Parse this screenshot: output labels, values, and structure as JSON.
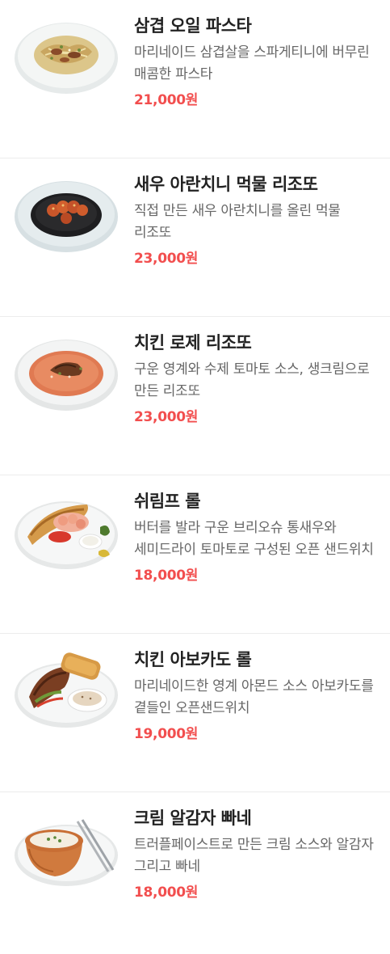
{
  "colors": {
    "title": "#222222",
    "description": "#666666",
    "price": "#f24e4e",
    "divider": "#ececec"
  },
  "menu": {
    "items": [
      {
        "name": "삼겹 오일 파스타",
        "description": "마리네이드 삼겹살을 스파게티니에 버무린 매콤한 파스타",
        "price": "21,000원",
        "image": "pasta-dish-photo"
      },
      {
        "name": "새우 아란치니 먹물 리조또",
        "description": "직접 만든 새우 아란치니를 올린 먹물 리조또",
        "price": "23,000원",
        "image": "squid-ink-risotto-photo"
      },
      {
        "name": "치킨 로제 리조또",
        "description": "구운 영계와 수제 토마토 소스, 생크림으로 만든 리조또",
        "price": "23,000원",
        "image": "rose-risotto-photo"
      },
      {
        "name": "쉬림프 롤",
        "description": "버터를 발라 구운 브리오슈 통새우와 세미드라이 토마토로 구성된 오픈 샌드위치",
        "price": "18,000원",
        "image": "shrimp-roll-photo"
      },
      {
        "name": "치킨 아보카도 롤",
        "description": "마리네이드한 영계 아몬드 소스 아보카도를 곁들인 오픈샌드위치",
        "price": "19,000원",
        "image": "chicken-avocado-roll-photo"
      },
      {
        "name": "크림 알감자 빠네",
        "description": "트러플페이스트로 만든 크림 소스와 알감자 그리고 빠네",
        "price": "18,000원",
        "image": "cream-bread-bowl-photo"
      }
    ]
  }
}
